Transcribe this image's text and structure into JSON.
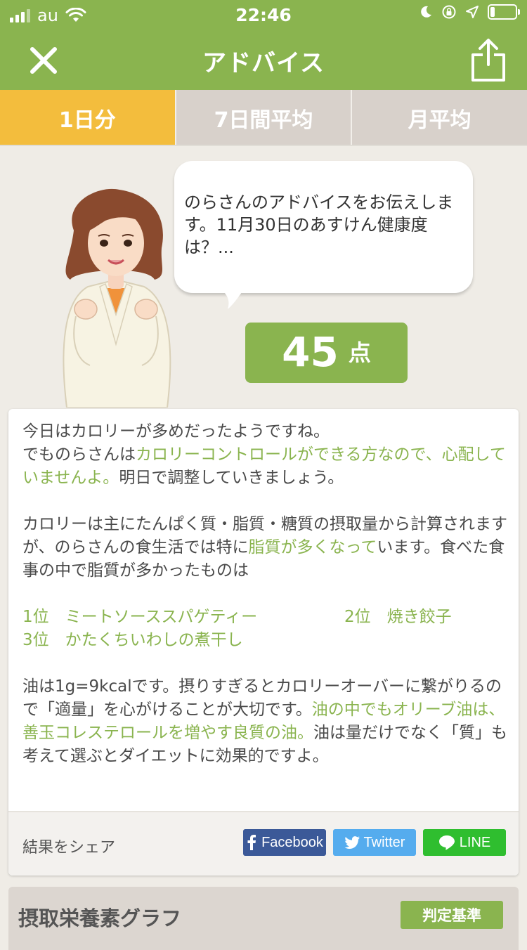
{
  "status": {
    "carrier": "au",
    "time": "22:46"
  },
  "nav": {
    "title": "アドバイス"
  },
  "tabs": [
    {
      "label": "1日分",
      "active": true
    },
    {
      "label": "7日間平均",
      "active": false
    },
    {
      "label": "月平均",
      "active": false
    }
  ],
  "bubble": {
    "text": "のらさんのアドバイスをお伝えします。11月30日のあすけん健康度は？..."
  },
  "score": {
    "value": "45",
    "unit": "点"
  },
  "advice": {
    "p1_plain1": "今日はカロリーが多めだったようですね。",
    "p1_plain2": "でものらさんは",
    "p1_hl": "カロリーコントロールができる方なので、心配していませんよ。",
    "p1_plain3": "明日で調整していきましょう。",
    "p2_plain1": "カロリーは主にたんぱく質・脂質・糖質の摂取量から計算されますが、のらさんの食生活では特に",
    "p2_hl": "脂質が多くなって",
    "p2_plain2": "います。食べた食事の中で脂質が多かったものは",
    "rank1": "1位　ミートソーススパゲティー",
    "rank2": "2位　焼き餃子",
    "rank3": "3位　かたくちいわしの煮干し",
    "p3_plain1": "油は1g=9kcalです。摂りすぎるとカロリーオーバーに繋がりるので「適量」を心がけることが大切です。",
    "p3_hl": "油の中でもオリーブ油は、善玉コレステロールを増やす良質の油。",
    "p3_plain2": "油は量だけでなく「質」も考えて選ぶとダイエットに効果的ですよ。"
  },
  "share": {
    "label": "結果をシェア",
    "facebook": "Facebook",
    "twitter": "Twitter",
    "line": "LINE"
  },
  "graph": {
    "title": "摂取栄養素グラフ",
    "criteria_button": "判定基準"
  },
  "colors": {
    "brand_green": "#8ab44f",
    "tab_active": "#f3bd3d",
    "tab_inactive": "#d8d1cb",
    "facebook": "#3b5998",
    "twitter": "#55acee",
    "line": "#2fbe2f"
  },
  "icons": {
    "close": "close-icon",
    "share": "share-icon",
    "facebook": "facebook-icon",
    "twitter": "twitter-bird-icon",
    "line": "line-chat-icon"
  }
}
